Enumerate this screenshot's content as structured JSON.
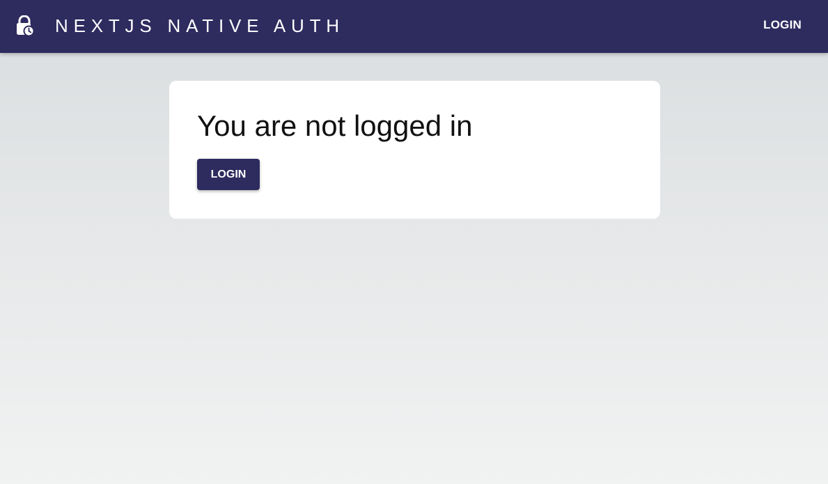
{
  "appbar": {
    "title": "NEXTJS NATIVE AUTH",
    "icon": "lock-clock-icon",
    "login_label": "LOGIN",
    "background_color": "#2e2b5f"
  },
  "main": {
    "card": {
      "heading": "You are not logged in",
      "login_label": "LOGIN"
    }
  },
  "colors": {
    "primary": "#2e2b5f",
    "card_background": "#ffffff",
    "page_background_top": "#d9dddf",
    "page_background_bottom": "#f1f2f2"
  }
}
